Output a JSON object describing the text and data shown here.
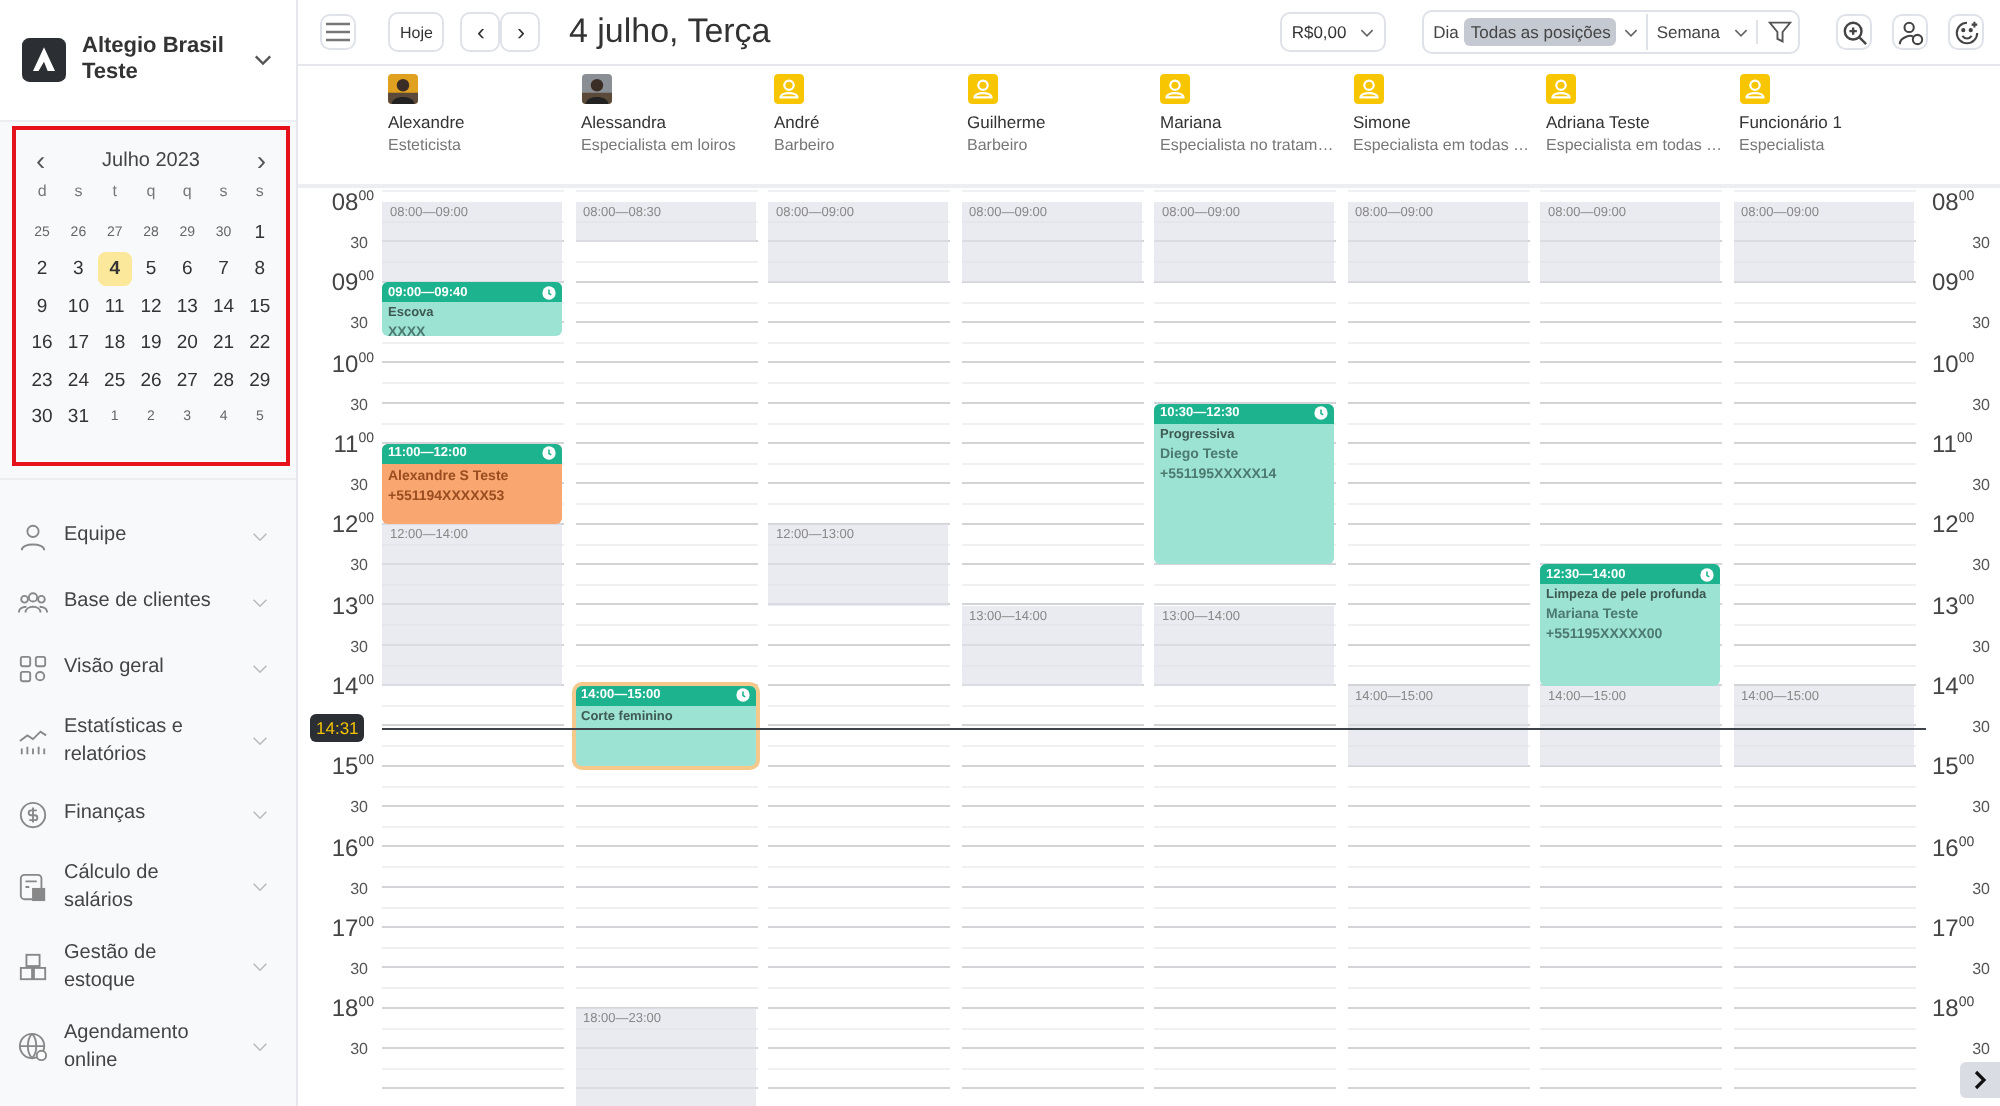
{
  "brand": {
    "name": "Altegio Brasil Teste"
  },
  "mini_calendar": {
    "month": "Julho 2023",
    "prev": "‹",
    "next": "›",
    "weekdays": [
      "d",
      "s",
      "t",
      "q",
      "q",
      "s",
      "s"
    ],
    "weeks": [
      [
        {
          "text": "25",
          "muted": true,
          "selected": false
        },
        {
          "text": "26",
          "muted": true,
          "selected": false
        },
        {
          "text": "27",
          "muted": true,
          "selected": false
        },
        {
          "text": "28",
          "muted": true,
          "selected": false
        },
        {
          "text": "29",
          "muted": true,
          "selected": false
        },
        {
          "text": "30",
          "muted": true,
          "selected": false
        },
        {
          "text": "1",
          "muted": false,
          "selected": false
        }
      ],
      [
        {
          "text": "2",
          "muted": false,
          "selected": false
        },
        {
          "text": "3",
          "muted": false,
          "selected": false
        },
        {
          "text": "4",
          "muted": false,
          "selected": true
        },
        {
          "text": "5",
          "muted": false,
          "selected": false
        },
        {
          "text": "6",
          "muted": false,
          "selected": false
        },
        {
          "text": "7",
          "muted": false,
          "selected": false
        },
        {
          "text": "8",
          "muted": false,
          "selected": false
        }
      ],
      [
        {
          "text": "9",
          "muted": false,
          "selected": false
        },
        {
          "text": "10",
          "muted": false,
          "selected": false
        },
        {
          "text": "11",
          "muted": false,
          "selected": false
        },
        {
          "text": "12",
          "muted": false,
          "selected": false
        },
        {
          "text": "13",
          "muted": false,
          "selected": false
        },
        {
          "text": "14",
          "muted": false,
          "selected": false
        },
        {
          "text": "15",
          "muted": false,
          "selected": false
        }
      ],
      [
        {
          "text": "16",
          "muted": false,
          "selected": false
        },
        {
          "text": "17",
          "muted": false,
          "selected": false
        },
        {
          "text": "18",
          "muted": false,
          "selected": false
        },
        {
          "text": "19",
          "muted": false,
          "selected": false
        },
        {
          "text": "20",
          "muted": false,
          "selected": false
        },
        {
          "text": "21",
          "muted": false,
          "selected": false
        },
        {
          "text": "22",
          "muted": false,
          "selected": false
        }
      ],
      [
        {
          "text": "23",
          "muted": false,
          "selected": false
        },
        {
          "text": "24",
          "muted": false,
          "selected": false
        },
        {
          "text": "25",
          "muted": false,
          "selected": false
        },
        {
          "text": "26",
          "muted": false,
          "selected": false
        },
        {
          "text": "27",
          "muted": false,
          "selected": false
        },
        {
          "text": "28",
          "muted": false,
          "selected": false
        },
        {
          "text": "29",
          "muted": false,
          "selected": false
        }
      ],
      [
        {
          "text": "30",
          "muted": false,
          "selected": false
        },
        {
          "text": "31",
          "muted": false,
          "selected": false
        },
        {
          "text": "1",
          "muted": true,
          "selected": false
        },
        {
          "text": "2",
          "muted": true,
          "selected": false
        },
        {
          "text": "3",
          "muted": true,
          "selected": false
        },
        {
          "text": "4",
          "muted": true,
          "selected": false
        },
        {
          "text": "5",
          "muted": true,
          "selected": false
        }
      ]
    ]
  },
  "sidebar": {
    "items": [
      "Equipe",
      "Base de clientes",
      "Visão geral",
      "Estatísticas e relatórios",
      "Finanças",
      "Cálculo de salários",
      "Gestão de estoque",
      "Agendamento online"
    ]
  },
  "toolbar": {
    "today": "Hoje",
    "prev": "‹",
    "next": "›",
    "title": "4 julho, Terça",
    "balance": "R$0,00",
    "view_day": "Dia",
    "positions": "Todas as posições",
    "view_week": "Semana"
  },
  "staff": [
    {
      "name": "Alexandre",
      "role": "Esteticista"
    },
    {
      "name": "Alessandra",
      "role": "Especialista em loiros"
    },
    {
      "name": "André",
      "role": "Barbeiro",
      "kind": "placeholder"
    },
    {
      "name": "Guilherme",
      "role": "Barbeiro",
      "kind": "placeholder"
    },
    {
      "name": "Mariana",
      "role": "Especialista no tratam…",
      "kind": "placeholder"
    },
    {
      "name": "Simone",
      "role": "Especialista em todas …",
      "kind": "placeholder"
    },
    {
      "name": "Adriana Teste",
      "role": "Especialista em todas …",
      "kind": "placeholder"
    },
    {
      "name": "Funcionário 1",
      "role": "Especialista",
      "kind": "placeholder"
    }
  ],
  "time_axis_left": [
    {
      "hour": "08",
      "minutes": "00",
      "half": "30"
    },
    {
      "hour": "09",
      "minutes": "00",
      "half": "30"
    },
    {
      "hour": "10",
      "minutes": "00",
      "half": "30"
    },
    {
      "hour": "11",
      "minutes": "00",
      "half": "30"
    },
    {
      "hour": "12",
      "minutes": "00",
      "half": "30"
    },
    {
      "hour": "13",
      "minutes": "00",
      "half": "30"
    },
    {
      "hour": "14",
      "minutes": "00"
    },
    {
      "hour": "15",
      "minutes": "00",
      "half": "30"
    },
    {
      "hour": "16",
      "minutes": "00",
      "half": "30"
    },
    {
      "hour": "17",
      "minutes": "00",
      "half": "30"
    },
    {
      "hour": "18",
      "minutes": "00",
      "half": "30"
    }
  ],
  "time_axis_right": [
    {
      "hour": "08",
      "minutes": "00",
      "half": "30"
    },
    {
      "hour": "09",
      "minutes": "00",
      "half": "30"
    },
    {
      "hour": "10",
      "minutes": "00",
      "half": "30"
    },
    {
      "hour": "11",
      "minutes": "00",
      "half": "30"
    },
    {
      "hour": "12",
      "minutes": "00",
      "half": "30"
    },
    {
      "hour": "13",
      "minutes": "00",
      "half": "30"
    },
    {
      "hour": "14",
      "minutes": "00",
      "half": "30"
    },
    {
      "hour": "15",
      "minutes": "00",
      "half": "30"
    },
    {
      "hour": "16",
      "minutes": "00",
      "half": "30"
    },
    {
      "hour": "17",
      "minutes": "00",
      "half": "30"
    },
    {
      "hour": "18",
      "minutes": "00",
      "half": "30"
    }
  ],
  "columns": [
    [
      {
        "kind": "break",
        "time": "08:00—09:00"
      },
      {
        "kind": "appointment",
        "time": "09:00—09:40",
        "service": "Escova",
        "client": "XXXX",
        "color": "#9de3d4",
        "selected": false
      },
      {
        "kind": "appointment",
        "time": "11:00—12:00",
        "client": "Alexandre S Teste",
        "phone": "+551194XXXXX53",
        "color": "#f9a670",
        "selected": false
      },
      {
        "kind": "break",
        "time": "12:00—14:00"
      }
    ],
    [
      {
        "kind": "break",
        "time": "08:00—08:30"
      },
      {
        "kind": "appointment",
        "time": "14:00—15:00",
        "service": "Corte feminino",
        "color": "#9de3d4",
        "selected": true
      },
      {
        "kind": "break",
        "time": "18:00—23:00"
      }
    ],
    [
      {
        "kind": "break",
        "time": "08:00—09:00"
      },
      {
        "kind": "break",
        "time": "12:00—13:00"
      }
    ],
    [
      {
        "kind": "break",
        "time": "08:00—09:00"
      },
      {
        "kind": "break",
        "time": "13:00—14:00"
      }
    ],
    [
      {
        "kind": "break",
        "time": "08:00—09:00"
      },
      {
        "kind": "appointment",
        "time": "10:30—12:30",
        "service": "Progressiva",
        "client": "Diego Teste",
        "phone": "+551195XXXXX14",
        "color": "#9de3d4",
        "selected": false
      },
      {
        "kind": "break",
        "time": "13:00—14:00"
      }
    ],
    [
      {
        "kind": "break",
        "time": "08:00—09:00"
      },
      {
        "kind": "break",
        "time": "14:00—15:00"
      }
    ],
    [
      {
        "kind": "break",
        "time": "08:00—09:00"
      },
      {
        "kind": "appointment",
        "time": "12:30—14:00",
        "service": "Limpeza de pele profunda",
        "client": "Mariana Teste",
        "phone": "+551195XXXXX00",
        "color": "#9de3d4",
        "selected": false
      },
      {
        "kind": "break",
        "time": "14:00—15:00"
      }
    ],
    [
      {
        "kind": "break",
        "time": "08:00—09:00"
      },
      {
        "kind": "break",
        "time": "14:00—15:00"
      }
    ]
  ],
  "now": {
    "time": "14:31"
  }
}
